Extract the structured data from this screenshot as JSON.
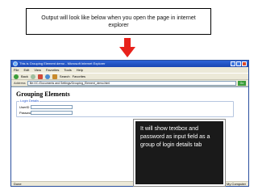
{
  "caption": "Output will look like below when you open the page in internet explorer",
  "browser": {
    "title": "This is Grouping Element demo - Microsoft Internet Explorer",
    "menu": [
      "File",
      "Edit",
      "View",
      "Favorites",
      "Tools",
      "Help"
    ],
    "toolbar": {
      "back": "Back",
      "search": "Search",
      "favorites": "Favorites"
    },
    "address_label": "Address",
    "address_value": "file:///C:/Documents and Settings/Grouping_Element_demo.html",
    "go": "Go",
    "status_left": "Done",
    "status_right": "My Computer"
  },
  "page": {
    "heading": "Grouping Elements",
    "legend": "Login Details",
    "fields": [
      {
        "label": "UserID"
      },
      {
        "label": "Password"
      }
    ]
  },
  "callout": "It will show textbox and password as input field as a group of login details tab",
  "colors": {
    "arrow": "#e8221b",
    "callout_bg": "#1a1a1a",
    "titlebar": "#2d64d8"
  }
}
